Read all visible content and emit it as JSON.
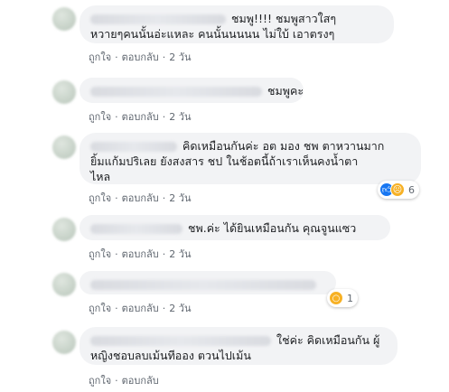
{
  "comments": [
    {
      "lines": [
        "ชมพู!!!! ชมพูสาวใสๆ",
        "หวายๆคนนั้นอ่ะแหละ คนนั้นนนนน ไม่ใบ้ เอาตรงๆ"
      ],
      "actions": {
        "like": "ถูกใจ",
        "reply": "ตอบกลับ",
        "time": "2 วัน"
      }
    },
    {
      "lines": [
        "ชมพูคะ"
      ],
      "actions": {
        "like": "ถูกใจ",
        "reply": "ตอบกลับ",
        "time": "2 วัน"
      }
    },
    {
      "lines": [
        "คิดเหมือนกันค่ะ อต มอง ชพ ตาหวานมาก",
        "ยิ้มแก้มปริเลย ยังสงสาร ชป ในช้อตนี้ถ้าเราเห็นคงน้ำตา",
        "ไหล"
      ],
      "actions": {
        "like": "ถูกใจ",
        "reply": "ตอบกลับ",
        "time": "2 วัน"
      },
      "reactions": {
        "icons": [
          "like-icon",
          "sad-icon"
        ],
        "count": "6"
      }
    },
    {
      "lines": [
        "ชพ.ค่ะ ได้ยินเหมือนกัน คุณจูนแซว"
      ],
      "actions": {
        "like": "ถูกใจ",
        "reply": "ตอบกลับ",
        "time": "2 วัน"
      }
    },
    {
      "lines": [],
      "actions": {
        "like": "ถูกใจ",
        "reply": "ตอบกลับ",
        "time": "2 วัน"
      },
      "reactions": {
        "icons": [
          "wow-icon"
        ],
        "count": "1"
      }
    },
    {
      "lines": [
        "ใช่ค่ะ คิดเหมือนกัน ผู้",
        "หญิงชอบลบเม้นทีออง ตวนไปเม้น"
      ],
      "actions": {
        "like": "ถูกใจ",
        "reply": "ตอบกลับ"
      }
    }
  ]
}
